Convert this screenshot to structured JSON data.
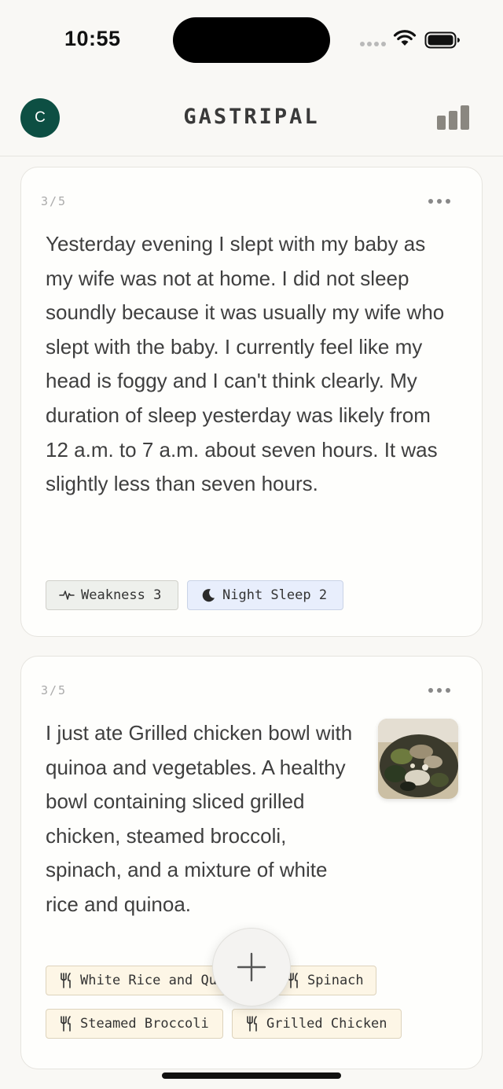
{
  "status": {
    "time": "10:55"
  },
  "header": {
    "avatar_initial": "C",
    "title": "GASTRIPAL",
    "stats_icon": "bar-chart-icon"
  },
  "entries": [
    {
      "counter": "3/5",
      "text": "Yesterday evening I slept with my baby as my wife was not at home. I did not sleep soundly because it was usually my wife who slept with the baby. I currently feel like my head is foggy and I can't think clearly. My duration of sleep yesterday was likely from 12 a.m. to 7 a.m. about seven hours. It was slightly less than seven hours.",
      "tags": [
        {
          "label": "Weakness 3",
          "icon": "pulse-icon",
          "kind": "symptom"
        },
        {
          "label": "Night Sleep 2",
          "icon": "moon-icon",
          "kind": "sleep"
        }
      ]
    },
    {
      "counter": "3/5",
      "text": "I just ate Grilled chicken bowl with quinoa and vegetables. A healthy bowl containing sliced grilled chicken, steamed broccoli, spinach, and a mixture of white rice and quinoa.",
      "image": "grilled-chicken-bowl-photo",
      "tags": [
        {
          "label": "White Rice and Quinoa",
          "icon": "utensils-icon",
          "kind": "food"
        },
        {
          "label": "Spinach",
          "icon": "utensils-icon",
          "kind": "food"
        },
        {
          "label": "Steamed Broccoli",
          "icon": "utensils-icon",
          "kind": "food"
        },
        {
          "label": "Grilled Chicken",
          "icon": "utensils-icon",
          "kind": "food"
        }
      ]
    }
  ],
  "fab": {
    "icon": "plus-icon"
  },
  "colors": {
    "background": "#f9f8f5",
    "avatar": "#0d4f43",
    "symptom_tag": "#eef0ec",
    "sleep_tag": "#e8eefc",
    "food_tag": "#fdf6e6"
  }
}
